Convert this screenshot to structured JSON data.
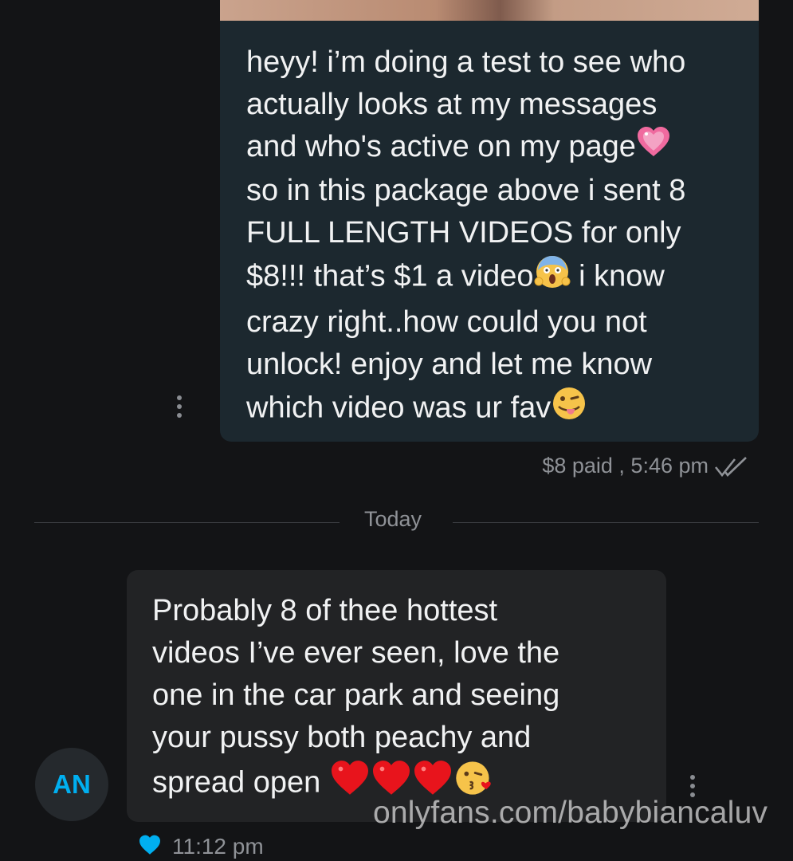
{
  "outgoing_message": {
    "lines": [
      "heyy! i’m doing a test to see who",
      "actually looks at my messages",
      "and who's active on my page",
      "so in this package above i sent 8",
      "FULL LENGTH VIDEOS for only",
      "$8!!! that’s $1 a video",
      " i know",
      "crazy right..how could you not",
      "unlock! enjoy and let me know",
      "which video was ur fav"
    ],
    "meta": "$8 paid , 5:46 pm",
    "emojis": [
      "sparkling-heart-emoji",
      "screaming-face-emoji",
      "winking-tongue-emoji"
    ]
  },
  "divider": {
    "label": "Today"
  },
  "incoming_message": {
    "lines": [
      "Probably 8 of thee hottest",
      "videos I’ve ever seen, love the",
      "one in the car park and seeing",
      "your pussy both peachy and",
      "spread open "
    ],
    "emojis": [
      "red-heart-emoji",
      "red-heart-emoji",
      "red-heart-emoji",
      "kissing-face-emoji"
    ],
    "time": "11:12 pm",
    "liked": true
  },
  "sender": {
    "initials": "AN"
  },
  "watermark": "onlyfans.com/babybiancaluv",
  "colors": {
    "background": "#131416",
    "outgoing_bubble": "#1c282f",
    "incoming_bubble": "#222325",
    "accent": "#00aff0",
    "muted_text": "#8f9297"
  }
}
